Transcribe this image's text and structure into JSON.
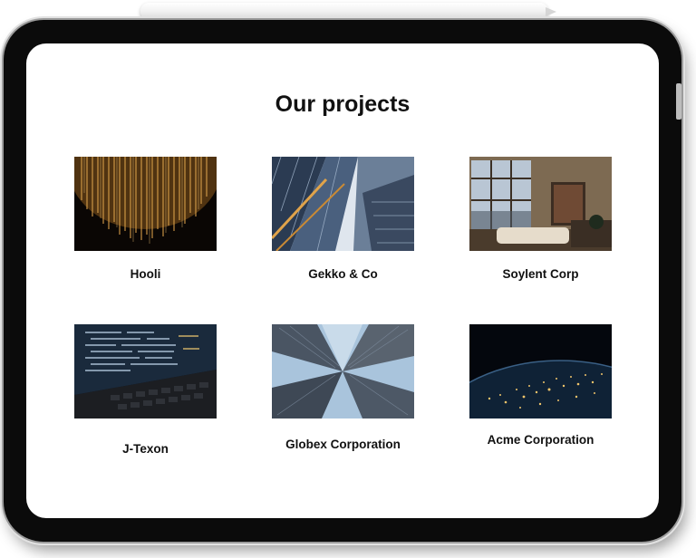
{
  "page": {
    "title": "Our projects"
  },
  "projects": [
    {
      "name": "Hooli",
      "image": "golden-light-strands"
    },
    {
      "name": "Gekko & Co",
      "image": "skyscraper-looking-up"
    },
    {
      "name": "Soylent Corp",
      "image": "living-room-interior"
    },
    {
      "name": "J-Texon",
      "image": "laptop-code-screen"
    },
    {
      "name": "Globex Corporation",
      "image": "city-towers-sky"
    },
    {
      "name": "Acme Corporation",
      "image": "earth-at-night"
    }
  ]
}
